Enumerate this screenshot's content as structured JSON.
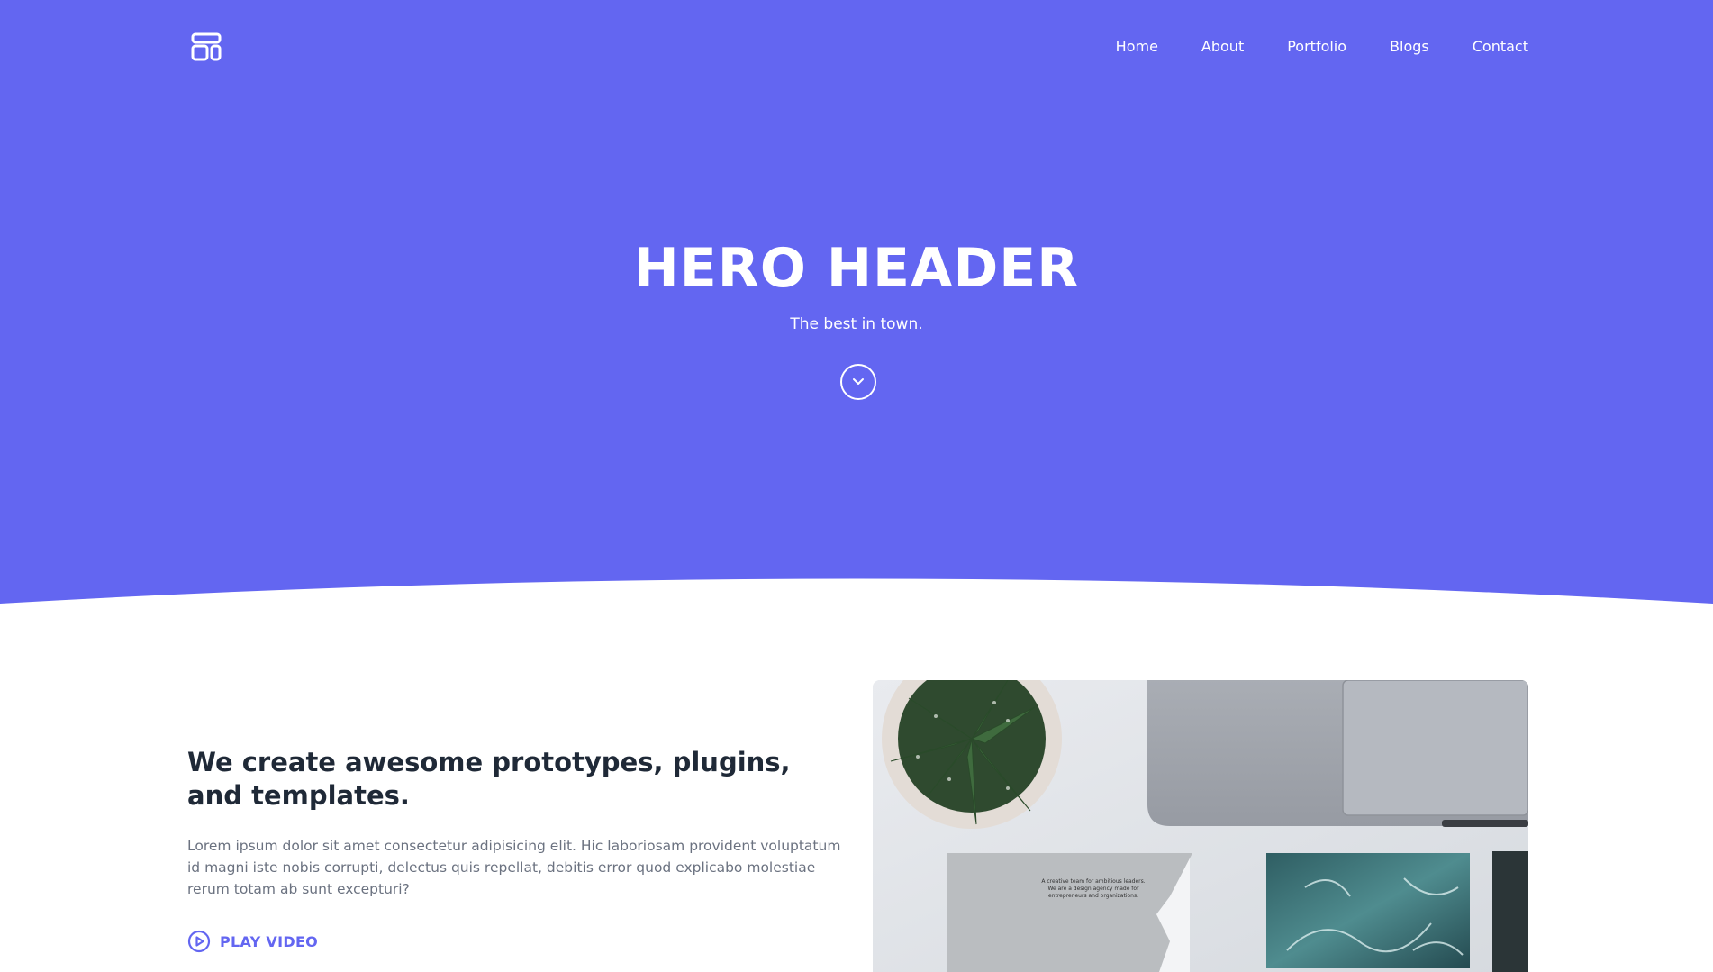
{
  "colors": {
    "brand": "#6366f1",
    "heading": "#1f2937",
    "body_text": "#6b7280",
    "white": "#ffffff"
  },
  "navbar": {
    "logo_icon": "layout-icon",
    "links": [
      "Home",
      "About",
      "Portfolio",
      "Blogs",
      "Contact"
    ]
  },
  "hero": {
    "title": "HERO HEADER",
    "subtitle": "The best in town.",
    "scroll_icon": "chevron-down-circle-icon"
  },
  "feature": {
    "heading": "We create awesome prototypes, plugins, and templates.",
    "body": "Lorem ipsum dolor sit amet consectetur adipisicing elit. Hic laboriosam provident voluptatum id magni iste nobis corrupti, delectus quis repellat, debitis error quod explicabo molestiae rerum totam ab sunt excepturi?",
    "play_icon": "play-circle-icon",
    "play_label": "PLAY VIDEO",
    "card_text": "A creative team for ambitious leaders. We are a design agency made for entrepreneurs and organizations."
  }
}
